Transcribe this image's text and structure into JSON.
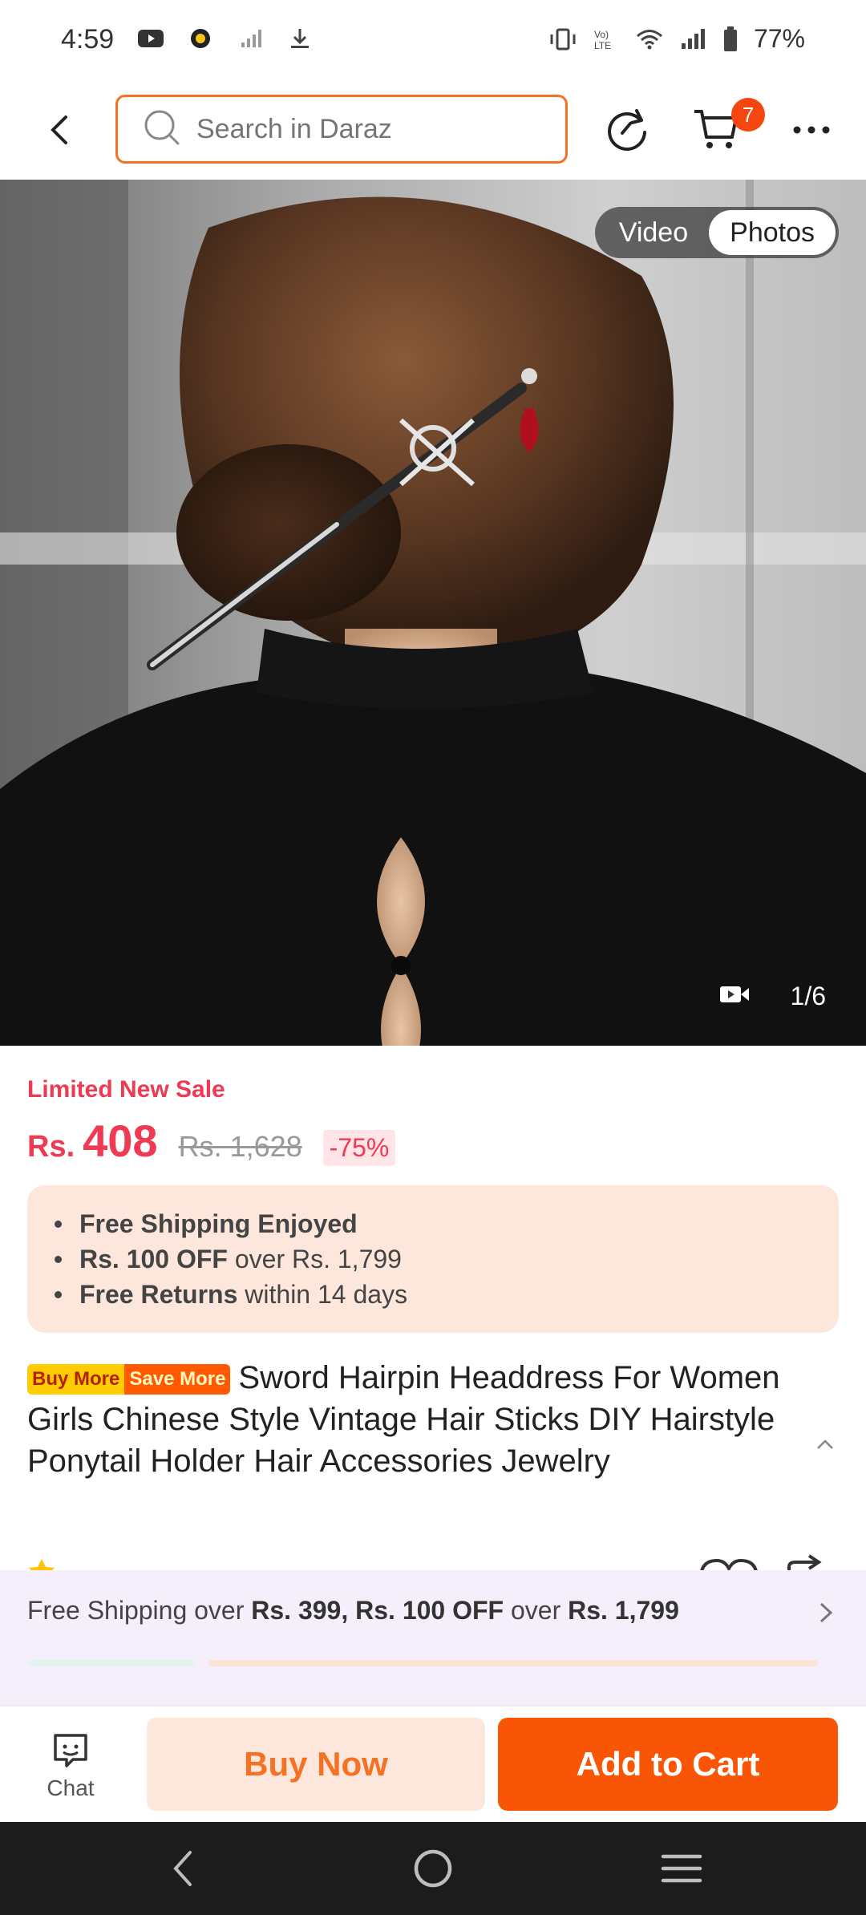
{
  "status_bar": {
    "time": "4:59",
    "battery": "77%",
    "left_icons": [
      "youtube-icon",
      "app-icon",
      "no-signal-icon",
      "download-icon"
    ],
    "right_icons": [
      "vibrate-icon",
      "volte-icon",
      "wifi-icon",
      "signal-icon",
      "battery-icon"
    ]
  },
  "top_nav": {
    "search_placeholder": "Search in Daraz",
    "cart_count": "7",
    "icons": [
      "back-icon",
      "search-icon",
      "refresh-icon",
      "cart-icon",
      "more-icon"
    ]
  },
  "gallery": {
    "tabs": [
      {
        "label": "Video",
        "active": false
      },
      {
        "label": "Photos",
        "active": true
      }
    ],
    "counter": "1/6"
  },
  "price": {
    "promo_label": "Limited New Sale",
    "currency": "Rs.",
    "current": "408",
    "original": "Rs. 1,628",
    "discount": "-75%"
  },
  "benefits": {
    "line1_bold": "Free Shipping Enjoyed",
    "line2_bold": "Rs. 100 OFF",
    "line2_rest": " over Rs. 1,799",
    "line3_bold": "Free Returns",
    "line3_rest": " within 14 days"
  },
  "product": {
    "tag_a": "Buy More",
    "tag_b": "Save More",
    "title": "Sword Hairpin Headdress For Women Girls Chinese Style Vintage Hair Sticks DIY Hairstyle Ponytail Holder Hair Accessories Jewelry"
  },
  "shipping": {
    "prefix": "Free Shipping over ",
    "bold1": "Rs. 399, Rs. 100 OFF",
    "mid": " over ",
    "bold2": "Rs. 1,799"
  },
  "actions": {
    "chat_label": "Chat",
    "buy_now": "Buy Now",
    "add_to_cart": "Add to Cart"
  },
  "colors": {
    "accent": "#f85606",
    "price_red": "#ee3a52",
    "benefits_bg": "#fde6db",
    "shipping_bg": "#f4effa"
  }
}
